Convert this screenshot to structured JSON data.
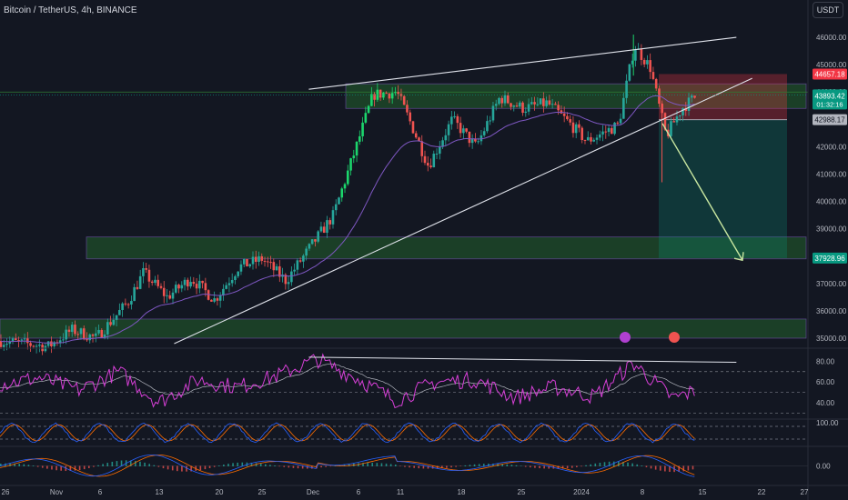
{
  "header": {
    "symbol": "Bitcoin / TetherUS, 4h, BINANCE",
    "currency": "USDT"
  },
  "badges": {
    "resistance": "44657.18",
    "last_price": "43893.42",
    "countdown": "01:32:16",
    "entry": "42988.17",
    "target": "37928.96"
  },
  "colors": {
    "background": "#131722",
    "up": "#26a69a",
    "up_bright": "#1bd66c",
    "down": "#ef5350",
    "zone_fill": "#1f4d2a",
    "trendline": "#e0e3eb",
    "rsi": "#d63fd6",
    "stoch_k": "#2962ff",
    "stoch_d": "#ff6d00",
    "target_arrow": "#c8e6a0",
    "badge_red": "#f23645",
    "badge_green": "#089981",
    "badge_blue": "#2962ff"
  },
  "chart_data": [
    {
      "type": "candlestick",
      "title": "Bitcoin / TetherUS, 4h, BINANCE",
      "x_ticks": [
        "26",
        "Nov",
        "6",
        "13",
        "20",
        "25",
        "Dec",
        "6",
        "11",
        "18",
        "25",
        "2024",
        "8",
        "15",
        "22",
        "27"
      ],
      "y_ticks": [
        35000,
        36000,
        37000,
        38000,
        39000,
        40000,
        41000,
        42000,
        43000,
        44000,
        45000,
        46000
      ],
      "ylim": [
        34800,
        46700
      ],
      "grid": false,
      "price_path": [
        {
          "t": 0,
          "price": 34900
        },
        {
          "t": 0.06,
          "price": 34700
        },
        {
          "t": 0.09,
          "price": 35300
        },
        {
          "t": 0.12,
          "price": 35000
        },
        {
          "t": 0.16,
          "price": 36300
        },
        {
          "t": 0.18,
          "price": 37400
        },
        {
          "t": 0.21,
          "price": 36500
        },
        {
          "t": 0.24,
          "price": 37200
        },
        {
          "t": 0.27,
          "price": 36400
        },
        {
          "t": 0.3,
          "price": 37600
        },
        {
          "t": 0.33,
          "price": 37900
        },
        {
          "t": 0.36,
          "price": 37100
        },
        {
          "t": 0.39,
          "price": 38300
        },
        {
          "t": 0.42,
          "price": 39500
        },
        {
          "t": 0.45,
          "price": 42100
        },
        {
          "t": 0.47,
          "price": 43900
        },
        {
          "t": 0.5,
          "price": 44000
        },
        {
          "t": 0.52,
          "price": 42700
        },
        {
          "t": 0.54,
          "price": 41300
        },
        {
          "t": 0.57,
          "price": 43000
        },
        {
          "t": 0.6,
          "price": 42000
        },
        {
          "t": 0.63,
          "price": 43800
        },
        {
          "t": 0.66,
          "price": 43400
        },
        {
          "t": 0.69,
          "price": 43600
        },
        {
          "t": 0.72,
          "price": 42800
        },
        {
          "t": 0.74,
          "price": 42200
        },
        {
          "t": 0.78,
          "price": 42800
        },
        {
          "t": 0.8,
          "price": 45700
        },
        {
          "t": 0.82,
          "price": 44900
        },
        {
          "t": 0.84,
          "price": 42400
        },
        {
          "t": 0.86,
          "price": 43400
        },
        {
          "t": 0.88,
          "price": 43900
        }
      ],
      "moving_average_color": "#7e57c2",
      "zones": [
        {
          "name": "resistance-zone",
          "from": 43400,
          "to": 44300
        },
        {
          "name": "support-zone-upper",
          "from": 37900,
          "to": 38700
        },
        {
          "name": "support-zone-lower",
          "from": 35000,
          "to": 35700
        }
      ],
      "trendlines": [
        {
          "name": "upper-wedge-line",
          "from": {
            "t": 0.39,
            "price": 44100
          },
          "to": {
            "t": 0.93,
            "price": 46000
          }
        },
        {
          "name": "lower-wedge-line",
          "from": {
            "t": 0.22,
            "price": 34800
          },
          "to": {
            "t": 0.95,
            "price": 44500
          }
        },
        {
          "name": "resistance-ray",
          "from": {
            "t": 0.42,
            "price": 44000
          },
          "to": {
            "t": 1.0,
            "price": 44000
          }
        }
      ],
      "short_position": {
        "entry": 42988.17,
        "stop": 44657.18,
        "target": 37928.96
      }
    },
    {
      "type": "line",
      "title": "",
      "y_ticks": [
        40,
        60,
        80
      ],
      "ylim": [
        25,
        90
      ],
      "reference_lines": [
        70,
        50,
        30
      ],
      "rsi_path": [
        {
          "t": 0,
          "v": 58
        },
        {
          "t": 0.05,
          "v": 64
        },
        {
          "t": 0.1,
          "v": 52
        },
        {
          "t": 0.15,
          "v": 70
        },
        {
          "t": 0.2,
          "v": 40
        },
        {
          "t": 0.25,
          "v": 62
        },
        {
          "t": 0.3,
          "v": 55
        },
        {
          "t": 0.35,
          "v": 66
        },
        {
          "t": 0.4,
          "v": 82
        },
        {
          "t": 0.45,
          "v": 64
        },
        {
          "t": 0.5,
          "v": 42
        },
        {
          "t": 0.55,
          "v": 60
        },
        {
          "t": 0.6,
          "v": 62
        },
        {
          "t": 0.65,
          "v": 45
        },
        {
          "t": 0.7,
          "v": 55
        },
        {
          "t": 0.75,
          "v": 46
        },
        {
          "t": 0.8,
          "v": 78
        },
        {
          "t": 0.85,
          "v": 44
        },
        {
          "t": 0.88,
          "v": 52
        }
      ],
      "divergence_line": {
        "from": {
          "t": 0.39,
          "v": 84
        },
        "to": {
          "t": 0.93,
          "v": 79
        }
      }
    },
    {
      "type": "line",
      "title": "",
      "y_ticks": [
        100
      ],
      "ylim": [
        -10,
        110
      ],
      "reference_lines": [
        80,
        20
      ]
    },
    {
      "type": "line",
      "title": "",
      "y_ticks": [
        0
      ],
      "ylim": [
        -1,
        1
      ]
    }
  ]
}
